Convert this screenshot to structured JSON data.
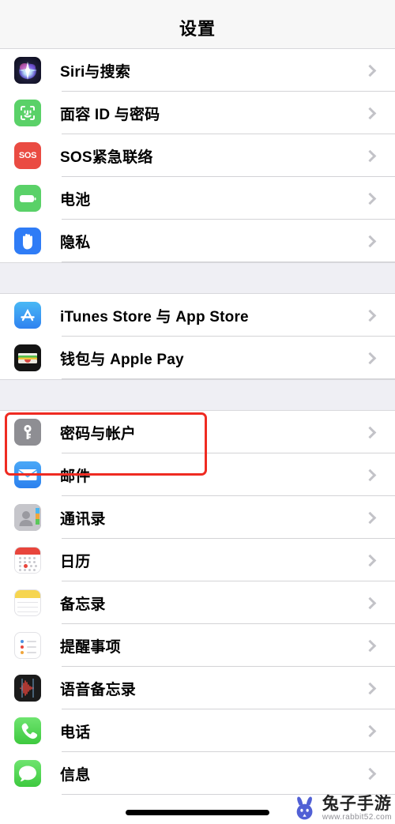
{
  "nav": {
    "title": "设置"
  },
  "colors": {
    "accent_highlight": "#ef2b22",
    "section_bg": "#efeff4",
    "row_bg": "#ffffff",
    "separator": "#d3d3d6",
    "chevron": "#c3c3c8",
    "nav_bg": "#f7f7f7"
  },
  "sections": [
    {
      "id": "system",
      "rows": [
        {
          "label": "Siri与搜索",
          "icon": "siri-icon",
          "chevron": true
        },
        {
          "label": "面容 ID 与密码",
          "icon": "faceid-icon",
          "chevron": true
        },
        {
          "label": "SOS紧急联络",
          "icon": "sos-icon",
          "chevron": true
        },
        {
          "label": "电池",
          "icon": "battery-icon",
          "chevron": true
        },
        {
          "label": "隐私",
          "icon": "privacy-hand-icon",
          "chevron": true
        }
      ]
    },
    {
      "id": "stores",
      "rows": [
        {
          "label": "iTunes Store 与 App Store",
          "icon": "app-store-icon",
          "chevron": true
        },
        {
          "label": "钱包与 Apple Pay",
          "icon": "wallet-icon",
          "chevron": true
        }
      ]
    },
    {
      "id": "apps",
      "rows": [
        {
          "label": "密码与帐户",
          "icon": "key-icon",
          "chevron": true,
          "highlighted": true
        },
        {
          "label": "邮件",
          "icon": "mail-icon",
          "chevron": true
        },
        {
          "label": "通讯录",
          "icon": "contacts-icon",
          "chevron": true
        },
        {
          "label": "日历",
          "icon": "calendar-icon",
          "chevron": true
        },
        {
          "label": "备忘录",
          "icon": "notes-icon",
          "chevron": true
        },
        {
          "label": "提醒事项",
          "icon": "reminders-icon",
          "chevron": true
        },
        {
          "label": "语音备忘录",
          "icon": "voice-memos-icon",
          "chevron": true
        },
        {
          "label": "电话",
          "icon": "phone-icon",
          "chevron": true
        },
        {
          "label": "信息",
          "icon": "messages-icon",
          "chevron": true
        }
      ]
    }
  ],
  "icon_labels": {
    "sos": "SOS"
  },
  "watermark": {
    "title": "兔子手游",
    "url": "www.rabbit52.com"
  }
}
